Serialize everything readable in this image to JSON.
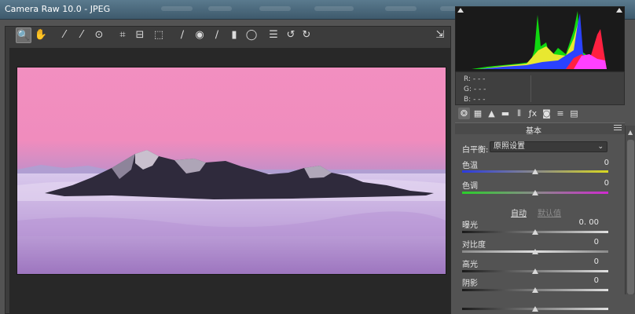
{
  "window": {
    "title": "Camera Raw 10.0  -  JPEG"
  },
  "toolbar": {
    "tools": [
      {
        "icon": "zoom-icon",
        "glyph": "🔍",
        "active": true
      },
      {
        "icon": "hand-icon",
        "glyph": "✋"
      },
      {
        "icon": "white-balance-icon",
        "glyph": "⁄"
      },
      {
        "icon": "color-sampler-icon",
        "glyph": "⁄"
      },
      {
        "icon": "targeted-adjust-icon",
        "glyph": "⊙"
      },
      {
        "icon": "crop-icon",
        "glyph": "⌗"
      },
      {
        "icon": "straighten-icon",
        "glyph": "⊟"
      },
      {
        "icon": "transform-icon",
        "glyph": "⬚"
      },
      {
        "icon": "spot-removal-icon",
        "glyph": "∕"
      },
      {
        "icon": "red-eye-icon",
        "glyph": "◉"
      },
      {
        "icon": "adjustment-brush-icon",
        "glyph": "∕"
      },
      {
        "icon": "graduated-filter-icon",
        "glyph": "▮"
      },
      {
        "icon": "radial-filter-icon",
        "glyph": "◯"
      },
      {
        "icon": "preferences-icon",
        "glyph": "☰"
      },
      {
        "icon": "rotate-ccw-icon",
        "glyph": "↺"
      },
      {
        "icon": "rotate-cw-icon",
        "glyph": "↻"
      },
      {
        "icon": "fullscreen-icon",
        "glyph": "⇲"
      }
    ]
  },
  "readout": {
    "r": "R:  - - -",
    "g": "G:  - - -",
    "b": "B:  - - -"
  },
  "panel": {
    "tab_icons": [
      "aperture-icon",
      "grid-icon",
      "mountain-icon",
      "split-icon",
      "lens-icon",
      "fx-icon",
      "camera-icon",
      "sliders-icon",
      "presets-icon"
    ],
    "header": "基本",
    "white_balance_label": "白平衡:",
    "white_balance_value": "原照设置",
    "sliders": [
      {
        "label": "色温",
        "value": "0",
        "level": 0.5
      },
      {
        "label": "色调",
        "value": "0",
        "level": 0.5
      },
      {
        "label": "曝光",
        "value": "0. 00",
        "level": 0.5
      },
      {
        "label": "对比度",
        "value": "0",
        "level": 0.5
      },
      {
        "label": "高光",
        "value": "0",
        "level": 0.5
      },
      {
        "label": "阴影",
        "value": "0",
        "level": 0.5
      }
    ],
    "auto_label": "自动",
    "default_label": "默认值"
  },
  "colors": {
    "accent_link": "#9fbfe0",
    "panel_bg": "#535353"
  }
}
